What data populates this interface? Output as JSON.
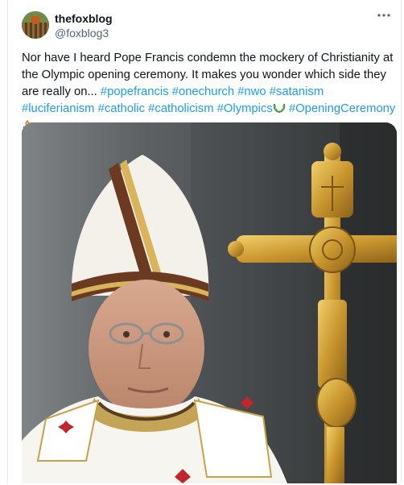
{
  "post": {
    "display_name": "thefoxblog",
    "handle": "@foxblog3",
    "more_icon": "more-horizontal-icon",
    "text_before": "Nor have I heard Pope Francis condemn the mockery of Christianity at the Olympic opening ceremony. It makes you wonder which side they are really on... ",
    "hashtags": [
      "#popefrancis",
      "#onechurch",
      "#nwo",
      "#satanism",
      "#luciferianism",
      "#catholic",
      "#catholicism",
      "#Olympics"
    ],
    "hashtag_final": "#OpeningCeremony",
    "emoji_after_olympics": "laurel-wreath-emoji",
    "emoji_after_ceremony": "torch-emoji"
  },
  "media": {
    "description_icon": "photo"
  }
}
